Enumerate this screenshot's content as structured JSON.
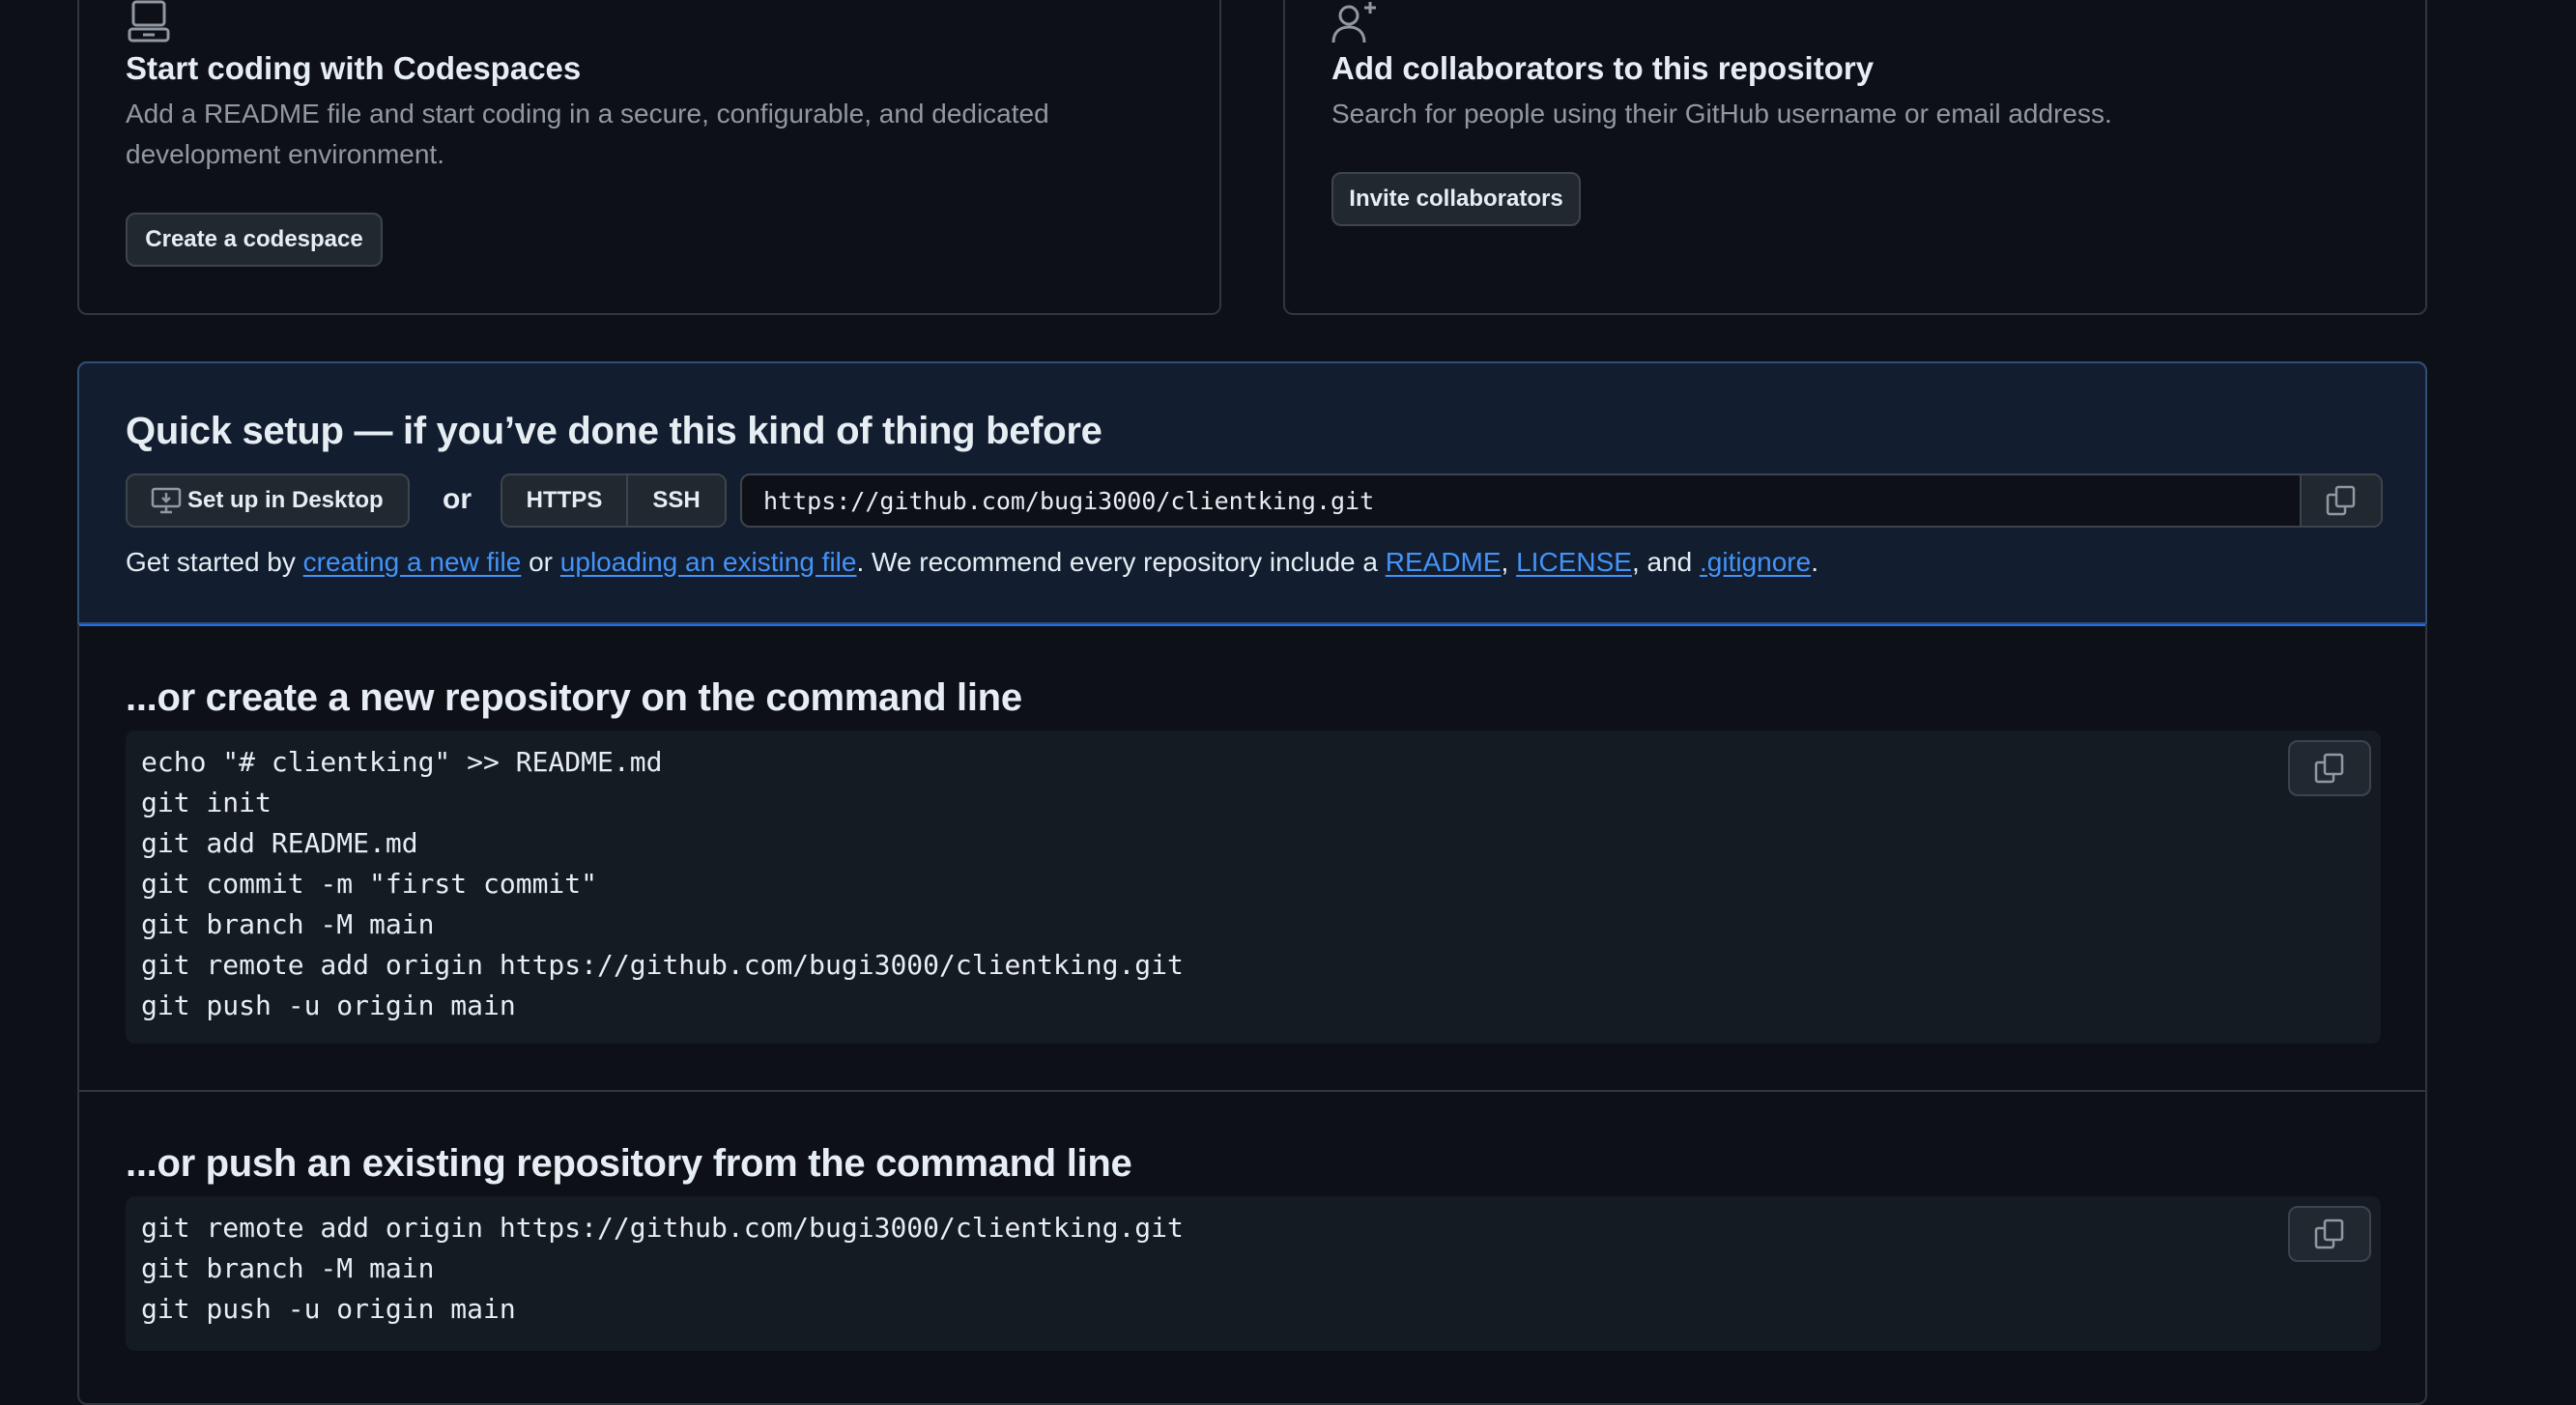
{
  "codespaces_card": {
    "icon": "laptop-icon",
    "title": "Start coding with Codespaces",
    "description": "Add a README file and start coding in a secure, configurable, and dedicated development environment.",
    "button_label": "Create a codespace"
  },
  "collab_card": {
    "icon": "person-add-icon",
    "title": "Add collaborators to this repository",
    "description": "Search for people using their GitHub username or email address.",
    "button_label": "Invite collaborators"
  },
  "quick_setup": {
    "title": "Quick setup — if you’ve done this kind of thing before",
    "desktop_button_label": "Set up in Desktop",
    "or_label": "or",
    "protocols": [
      "HTTPS",
      "SSH"
    ],
    "selected_protocol": "HTTPS",
    "clone_url": "https://github.com/bugi3000/clientking.git",
    "get_started": {
      "prefix": "Get started by ",
      "link_new_file": "creating a new file",
      "mid1": " or ",
      "link_upload": "uploading an existing file",
      "mid2": ". We recommend every repository include a ",
      "link_readme": "README",
      "sep1": ", ",
      "link_license": "LICENSE",
      "sep2": ", and ",
      "link_gitignore": ".gitignore",
      "suffix": "."
    }
  },
  "new_repo_section": {
    "title": "...or create a new repository on the command line",
    "lines": [
      "echo \"# clientking\" >> README.md",
      "git init",
      "git add README.md",
      "git commit -m \"first commit\"",
      "git branch -M main",
      "git remote add origin https://github.com/bugi3000/clientking.git",
      "git push -u origin main"
    ]
  },
  "push_existing_section": {
    "title": "...or push an existing repository from the command line",
    "lines": [
      "git remote add origin https://github.com/bugi3000/clientking.git",
      "git branch -M main",
      "git push -u origin main"
    ]
  },
  "colors": {
    "background": "#0d1117",
    "accent_link": "#4493f8",
    "quick_setup_bg": "#121d2f",
    "border": "#30363d"
  }
}
